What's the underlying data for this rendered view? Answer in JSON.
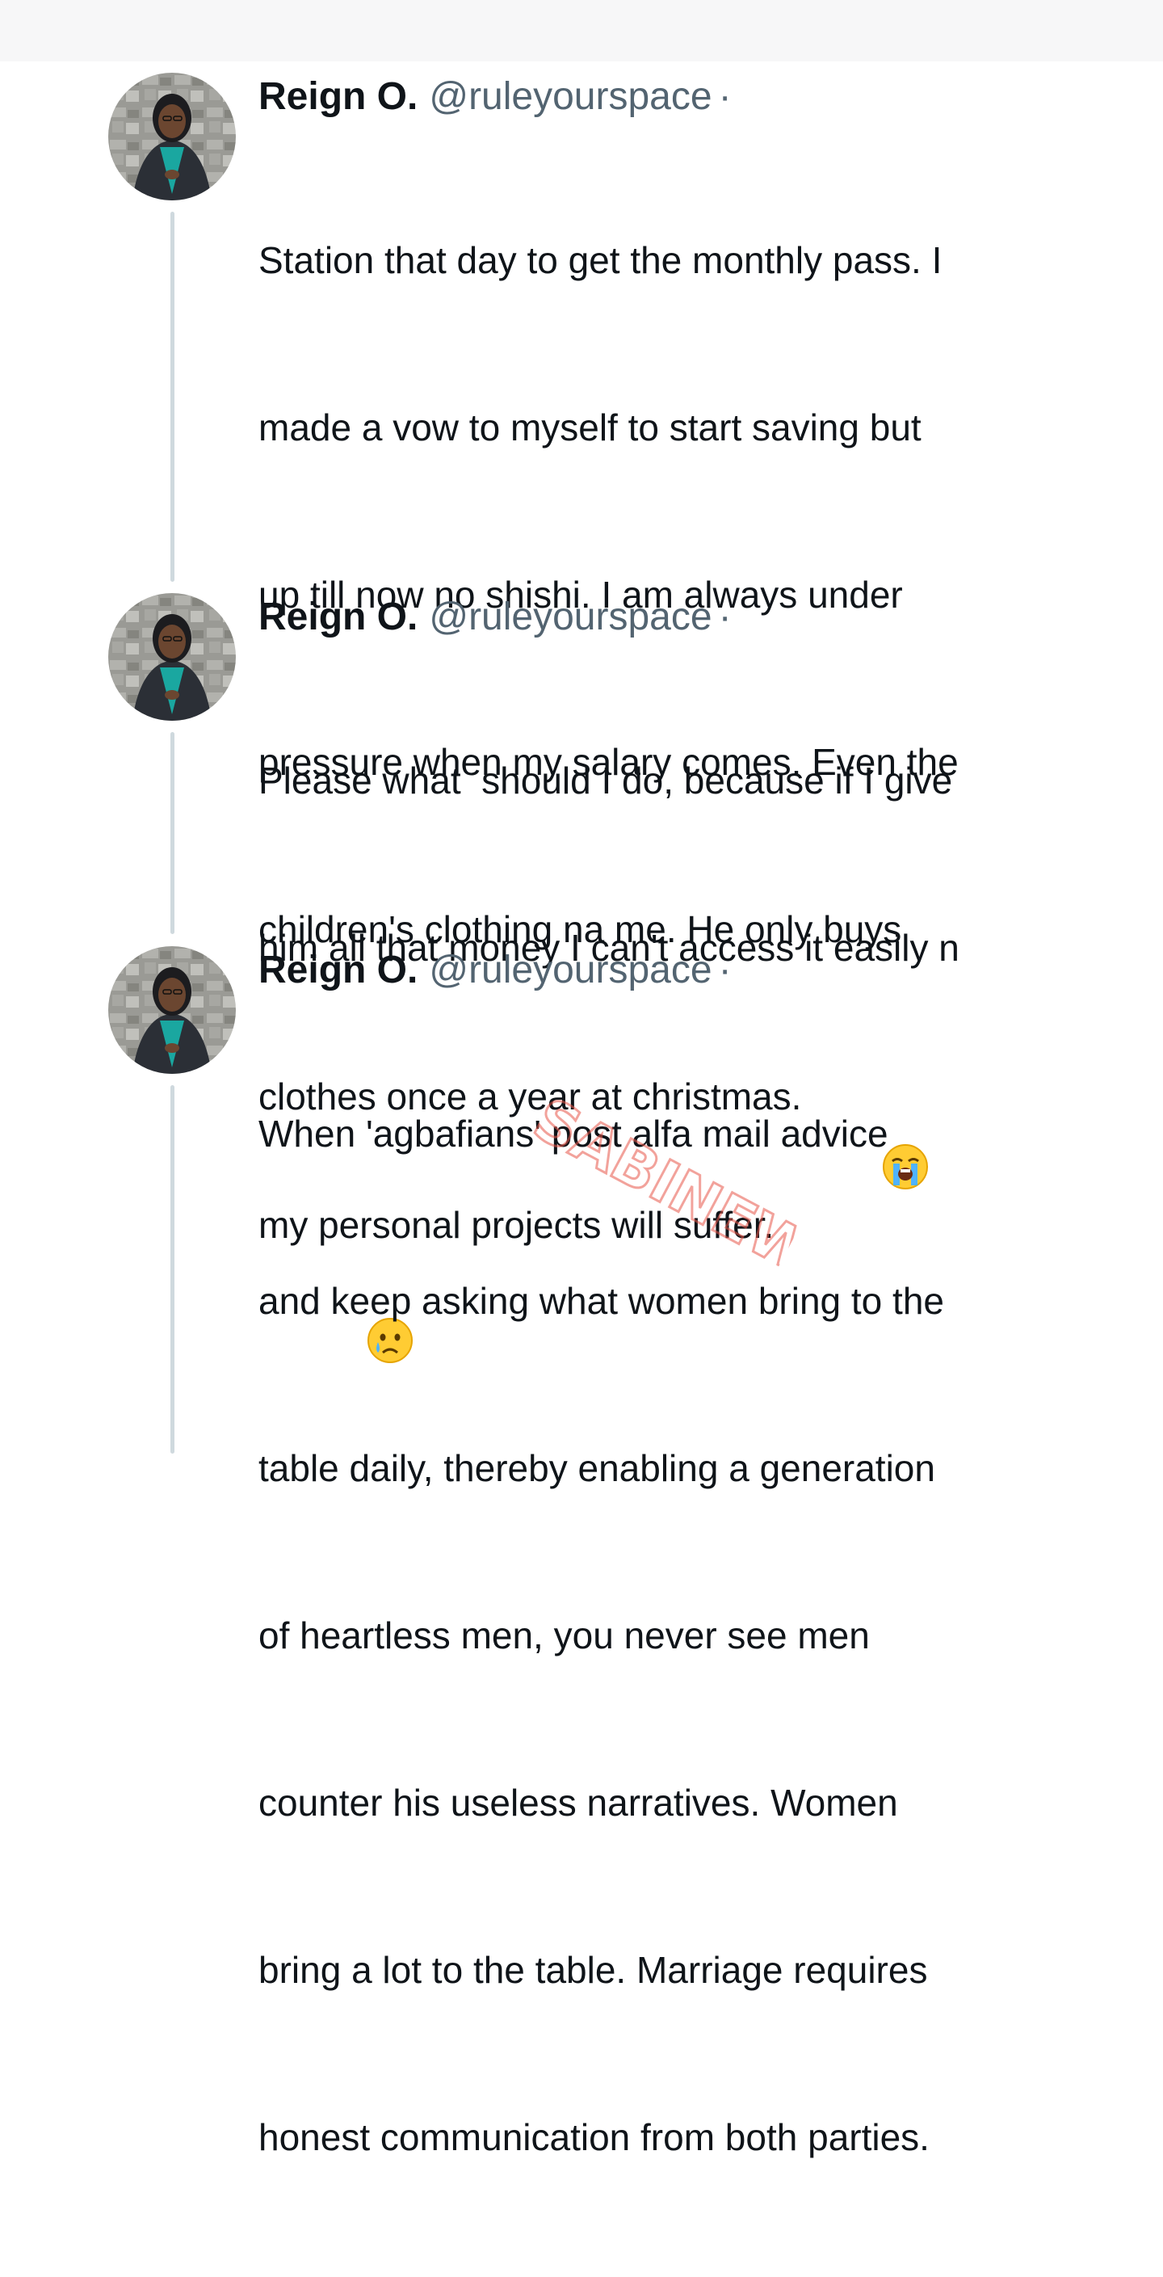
{
  "colors": {
    "name": "#0f1419",
    "handle": "#536471",
    "thread_line": "#cfd9de",
    "top_band": "#f7f7f8",
    "watermark": "#e8574a"
  },
  "tweets": [
    {
      "display_name": "Reign O.",
      "handle": "@ruleyourspace",
      "separator": "·",
      "lines": [
        "Station that day to get the monthly pass. I",
        "made a vow to myself to start saving but",
        "up till now no shishi. I am always under",
        "pressure when my salary comes. Even the",
        "children's clothing na me. He only buys",
        "clothes once a year at christmas."
      ]
    },
    {
      "display_name": "Reign O.",
      "handle": "@ruleyourspace",
      "separator": "·",
      "lines": [
        "Please what  should I do, because if I give",
        "him all that money I can't access it easily n",
        "my personal projects will suffer."
      ],
      "emojis": [
        "loudly-crying-face-emoji",
        "crying-face-emoji"
      ]
    },
    {
      "display_name": "Reign O.",
      "handle": "@ruleyourspace",
      "separator": "·",
      "lines": [
        "When 'agbafians' post alfa mail advice",
        "and keep asking what women bring to the",
        "table daily, thereby enabling a generation",
        "of heartless men, you never see men",
        "counter his useless narratives. Women",
        "bring a lot to the table. Marriage requires",
        "honest communication from both parties."
      ]
    }
  ],
  "watermark": {
    "text": "SABINEWS"
  }
}
